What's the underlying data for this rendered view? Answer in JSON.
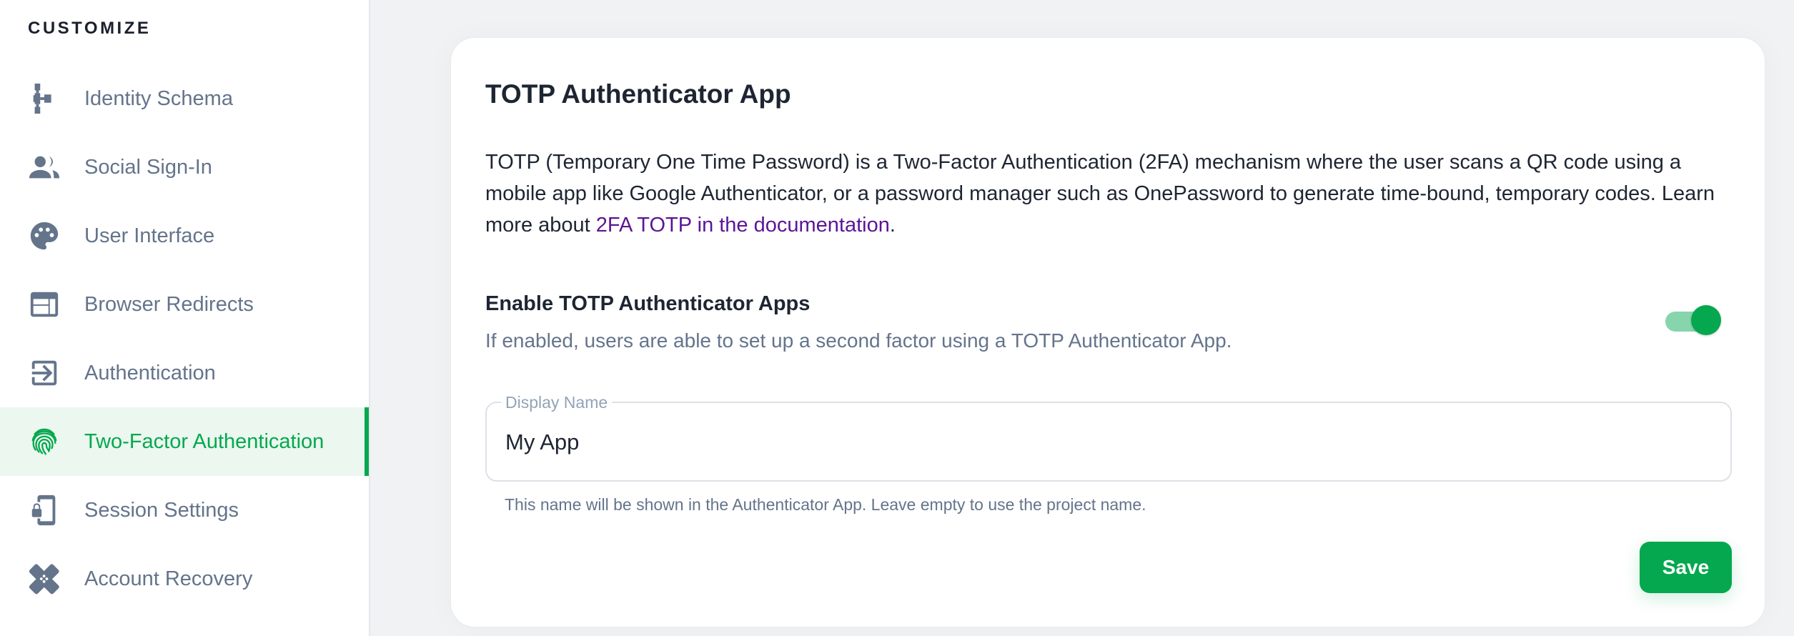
{
  "sidebar": {
    "heading": "CUSTOMIZE",
    "items": [
      {
        "label": "Identity Schema",
        "icon": "schema-icon",
        "active": false
      },
      {
        "label": "Social Sign-In",
        "icon": "users-icon",
        "active": false
      },
      {
        "label": "User Interface",
        "icon": "palette-icon",
        "active": false
      },
      {
        "label": "Browser Redirects",
        "icon": "browser-window-icon",
        "active": false
      },
      {
        "label": "Authentication",
        "icon": "login-icon",
        "active": false
      },
      {
        "label": "Two-Factor Authentication",
        "icon": "fingerprint-icon",
        "active": true
      },
      {
        "label": "Session Settings",
        "icon": "phone-lock-icon",
        "active": false
      },
      {
        "label": "Account Recovery",
        "icon": "bandage-icon",
        "active": false
      }
    ]
  },
  "card": {
    "title": "TOTP Authenticator App",
    "description": "TOTP (Temporary One Time Password) is a Two-Factor Authentication (2FA) mechanism where the user scans a QR code using a mobile app like Google Authenticator, or a password manager such as OnePassword to generate time-bound, temporary codes. Learn more about ",
    "doc_link": "2FA TOTP in the documentation",
    "description_end": ".",
    "toggle": {
      "title": "Enable TOTP Authenticator Apps",
      "description": "If enabled, users are able to set up a second factor using a TOTP Authenticator App.",
      "enabled": true
    },
    "display_name": {
      "label": "Display Name",
      "value": "My App",
      "help": "This name will be shown in the Authenticator App. Leave empty to use the project name."
    },
    "save_label": "Save"
  },
  "colors": {
    "accent": "#05a84f",
    "accent_light": "#86d5ac",
    "active_bg": "#ebf7ef",
    "link": "#5b1596",
    "muted_text": "#64748b"
  }
}
